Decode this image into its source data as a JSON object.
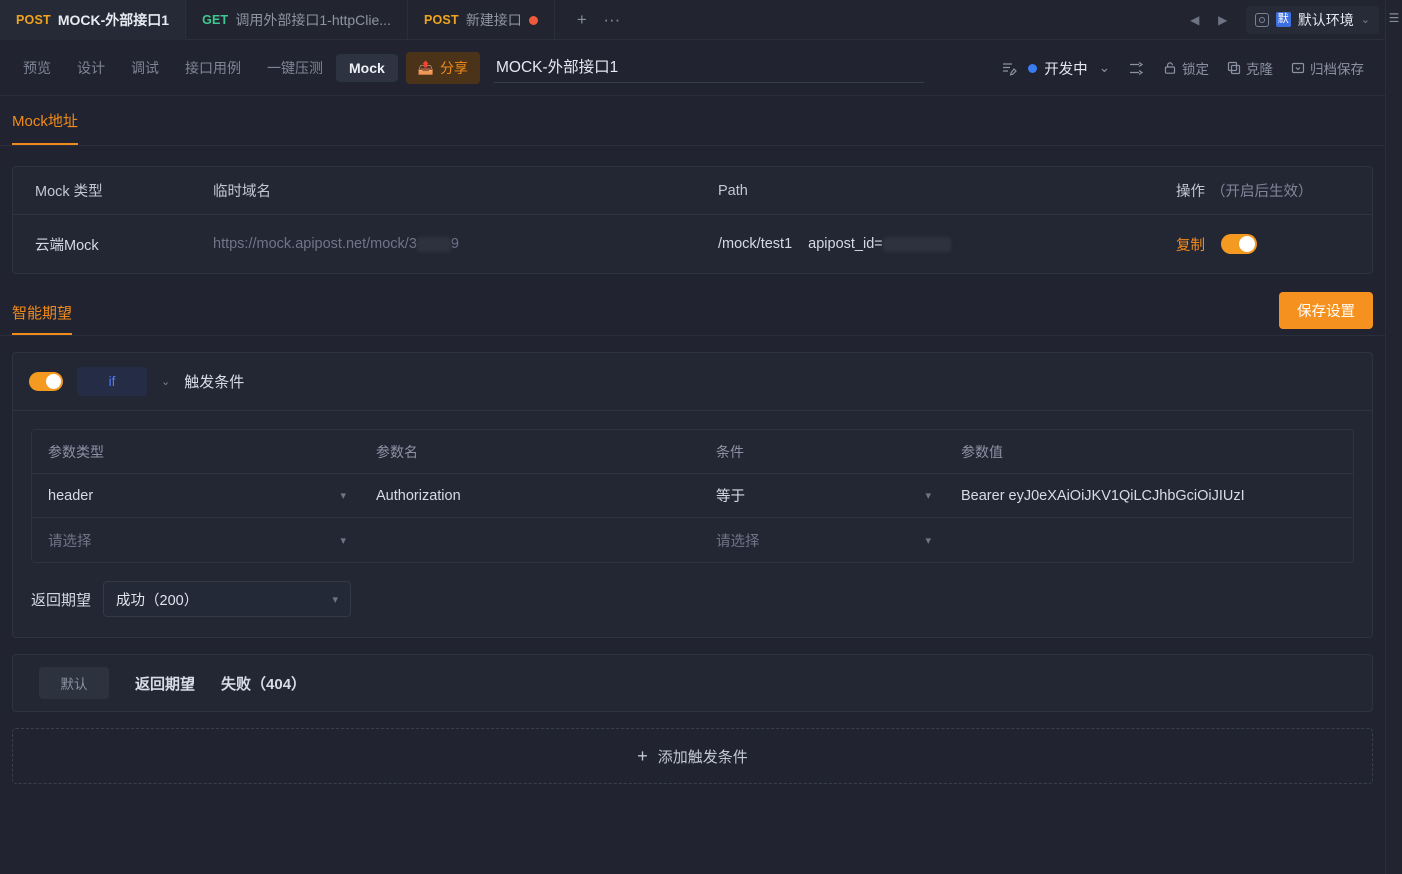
{
  "tabs": [
    {
      "method": "POST",
      "name": "MOCK-外部接口1",
      "active": true,
      "dirty": false
    },
    {
      "method": "GET",
      "name": "调用外部接口1-httpClie...",
      "active": false,
      "dirty": false
    },
    {
      "method": "POST",
      "name": "新建接口",
      "active": false,
      "dirty": true
    }
  ],
  "tabbar": {
    "add_label": "+",
    "more_label": "···",
    "prev_label": "◀",
    "next_label": "▶",
    "env_badge": "默",
    "env_name": "默认环境",
    "env_chevron": "⌄"
  },
  "toolbar": {
    "subtabs": [
      {
        "label": "预览",
        "active": false
      },
      {
        "label": "设计",
        "active": false
      },
      {
        "label": "调试",
        "active": false
      },
      {
        "label": "接口用例",
        "active": false
      },
      {
        "label": "一键压测",
        "active": false
      },
      {
        "label": "Mock",
        "active": true
      }
    ],
    "share_label": "分享",
    "title_value": "MOCK-外部接口1",
    "title_placeholder": "请输入接口名称",
    "status_label": "开发中",
    "status_color": "#3a7bf0",
    "status_chevron": "⌄",
    "actions": [
      {
        "label": "锁定",
        "icon": "lock-icon"
      },
      {
        "label": "克隆",
        "icon": "clone-icon"
      },
      {
        "label": "归档保存",
        "icon": "archive-icon"
      }
    ]
  },
  "mock_address": {
    "tab_label": "Mock地址",
    "headers": {
      "type": "Mock 类型",
      "domain": "临时域名",
      "path": "Path",
      "action": "操作",
      "action_sub": "（开启后生效）"
    },
    "row": {
      "type": "云端Mock",
      "domain_prefix": "https://mock.apipost.net/mock/3",
      "domain_suffix": "9",
      "path": "/mock/test1",
      "path_param_key": "apipost_id=",
      "copy_label": "复制",
      "enabled": true
    }
  },
  "smart_expect": {
    "tab_label": "智能期望",
    "save_label": "保存设置",
    "expectation": {
      "enabled": true,
      "operator": "if",
      "operator_chevron": "⌄",
      "title": "触发条件",
      "table_headers": {
        "param_type": "参数类型",
        "param_name": "参数名",
        "condition": "条件",
        "param_value": "参数值"
      },
      "rows": [
        {
          "param_type": "header",
          "param_name": "Authorization",
          "condition": "等于",
          "param_value": "Bearer eyJ0eXAiOiJKV1QiLCJhbGciOiJIUzI"
        },
        {
          "param_type": "请选择",
          "param_name": "",
          "condition": "请选择",
          "param_value": ""
        }
      ],
      "return_label": "返回期望",
      "return_value": "成功（200）",
      "chevron": "⌄"
    },
    "default_block": {
      "pill": "默认",
      "return_label": "返回期望",
      "return_value": "失败（404）"
    },
    "add_condition": {
      "plus": "+",
      "label": "添加触发条件"
    }
  }
}
